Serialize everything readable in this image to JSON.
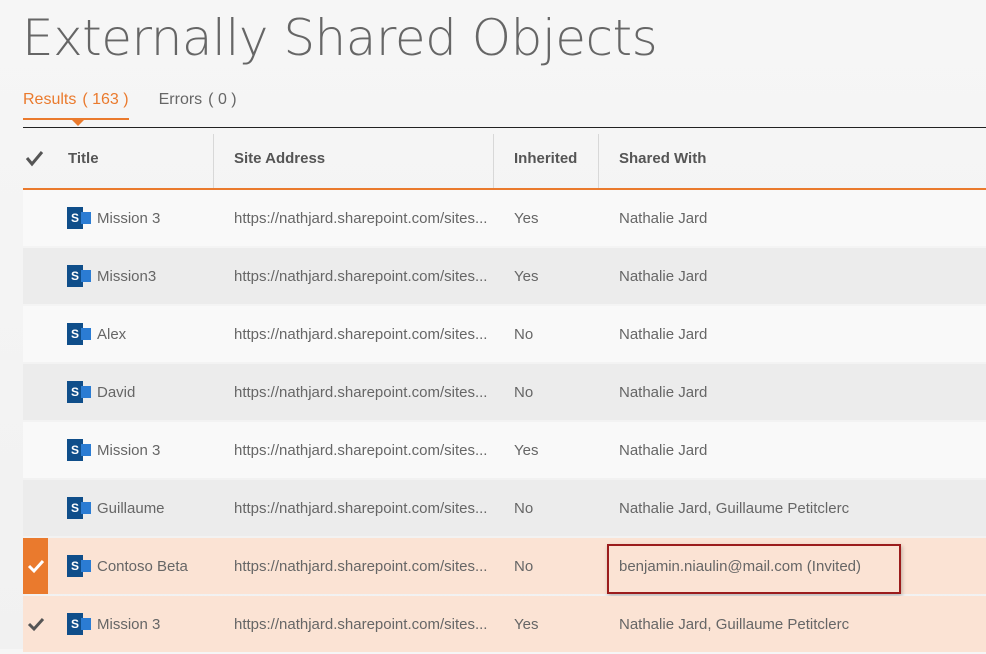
{
  "page": {
    "title": "Externally Shared Objects"
  },
  "tabs": [
    {
      "label": "Results",
      "count": "( 163 )"
    },
    {
      "label": "Errors",
      "count": "( 0 )"
    }
  ],
  "columns": {
    "title": "Title",
    "site_address": "Site Address",
    "inherited": "Inherited",
    "shared_with": "Shared With"
  },
  "colors": {
    "accent": "#ea7a2d",
    "sharepoint": "#0f4e8a",
    "highlight_box": "#9b1c1c"
  },
  "rows": [
    {
      "title": "Mission 3",
      "site": "https://nathjard.sharepoint.com/sites...",
      "inherited": "Yes",
      "shared": "Nathalie Jard",
      "checked": false,
      "icon": "sharepoint-icon"
    },
    {
      "title": "Mission3",
      "site": "https://nathjard.sharepoint.com/sites...",
      "inherited": "Yes",
      "shared": "Nathalie Jard",
      "checked": false,
      "icon": "sharepoint-icon"
    },
    {
      "title": "Alex",
      "site": "https://nathjard.sharepoint.com/sites...",
      "inherited": "No",
      "shared": "Nathalie Jard",
      "checked": false,
      "icon": "sharepoint-icon"
    },
    {
      "title": "David",
      "site": "https://nathjard.sharepoint.com/sites...",
      "inherited": "No",
      "shared": "Nathalie Jard",
      "checked": false,
      "icon": "sharepoint-icon"
    },
    {
      "title": "Mission 3",
      "site": "https://nathjard.sharepoint.com/sites...",
      "inherited": "Yes",
      "shared": "Nathalie Jard",
      "checked": false,
      "icon": "sharepoint-icon"
    },
    {
      "title": "Guillaume",
      "site": "https://nathjard.sharepoint.com/sites...",
      "inherited": "No",
      "shared": "Nathalie Jard, Guillaume Petitclerc",
      "checked": false,
      "icon": "sharepoint-icon"
    },
    {
      "title": "Contoso Beta",
      "site": "https://nathjard.sharepoint.com/sites...",
      "inherited": "No",
      "shared": "benjamin.niaulin@mail.com  (Invited)",
      "checked": true,
      "icon": "sharepoint-icon"
    },
    {
      "title": "Mission 3",
      "site": "https://nathjard.sharepoint.com/sites...",
      "inherited": "Yes",
      "shared": "Nathalie Jard, Guillaume Petitclerc",
      "checked": false,
      "icon": "sharepoint-icon"
    }
  ]
}
